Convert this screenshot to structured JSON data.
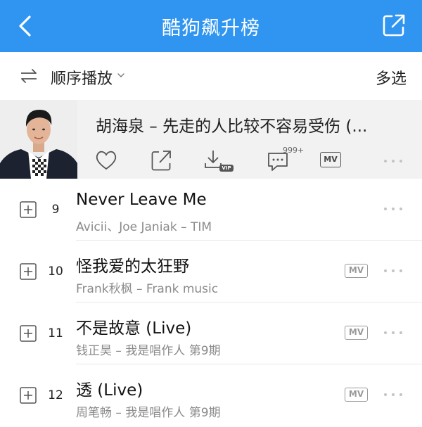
{
  "header": {
    "title": "酷狗飙升榜"
  },
  "toolbar": {
    "order_label": "顺序播放",
    "multi_select": "多选"
  },
  "current_song": {
    "title": "胡海泉 – 先走的人比较不容易受伤 (...",
    "comment_count": "999+",
    "mv_label": "MV",
    "download_badge": "VIP"
  },
  "songs": [
    {
      "rank": "9",
      "title": "Never Leave Me",
      "subtitle": "Avicii、Joe Janiak – TIM",
      "has_mv": false
    },
    {
      "rank": "10",
      "title": "怪我爱的太狂野",
      "subtitle": "Frank秋枫 – Frank music",
      "has_mv": true
    },
    {
      "rank": "11",
      "title": "不是故意 (Live)",
      "subtitle": "钱正昊 – 我是唱作人 第9期",
      "has_mv": true
    },
    {
      "rank": "12",
      "title": "透 (Live)",
      "subtitle": "周笔畅 – 我是唱作人 第9期",
      "has_mv": true
    }
  ],
  "mv_label": "MV",
  "colors": {
    "header_bg": "#2f95f0",
    "accent": "#2f95f0",
    "expanded_bg": "#f2f2f2"
  }
}
